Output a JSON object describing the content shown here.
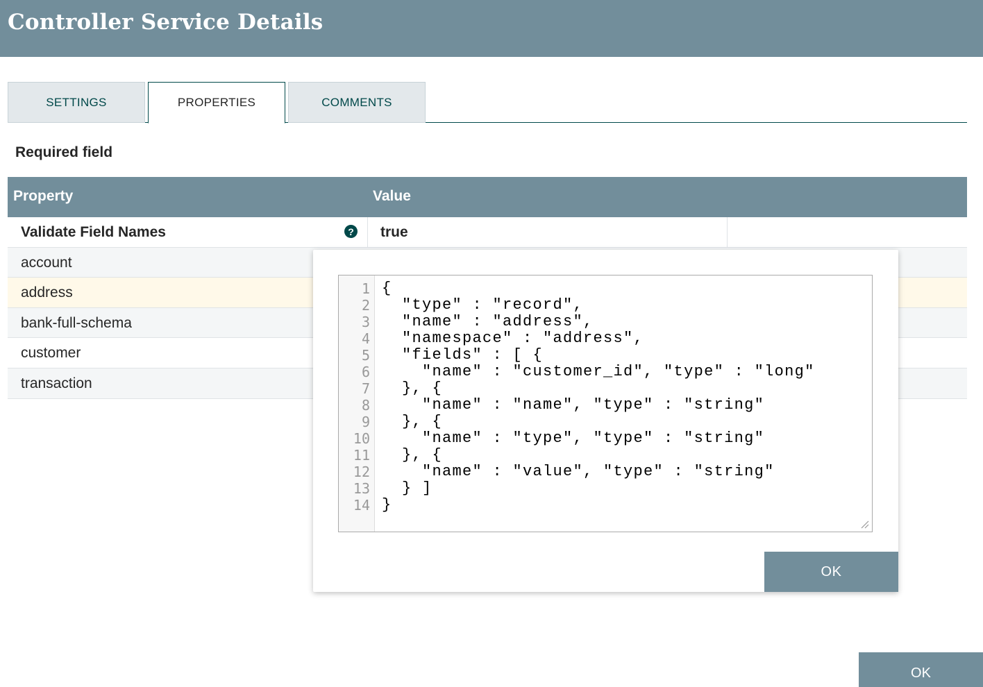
{
  "header": {
    "title": "Controller Service Details"
  },
  "tabs": [
    {
      "label": "SETTINGS",
      "active": false
    },
    {
      "label": "PROPERTIES",
      "active": true
    },
    {
      "label": "COMMENTS",
      "active": false
    }
  ],
  "required_label": "Required field",
  "table": {
    "headers": {
      "property": "Property",
      "value": "Value"
    },
    "rows": [
      {
        "name": "Validate Field Names",
        "value": "true",
        "required": true,
        "has_help": true
      },
      {
        "name": "account",
        "value": ""
      },
      {
        "name": "address",
        "value": "",
        "selected": true
      },
      {
        "name": "bank-full-schema",
        "value": ""
      },
      {
        "name": "customer",
        "value": ""
      },
      {
        "name": "transaction",
        "value": ""
      }
    ]
  },
  "editor": {
    "line_numbers": [
      "1",
      "2",
      "3",
      "4",
      "5",
      "6",
      "7",
      "8",
      "9",
      "10",
      "11",
      "12",
      "13",
      "14"
    ],
    "lines": [
      "{",
      "  \"type\" : \"record\",",
      "  \"name\" : \"address\",",
      "  \"namespace\" : \"address\",",
      "  \"fields\" : [ {",
      "    \"name\" : \"customer_id\", \"type\" : \"long\"",
      "  }, {",
      "    \"name\" : \"name\", \"type\" : \"string\"",
      "  }, {",
      "    \"name\" : \"type\", \"type\" : \"string\"",
      "  }, {",
      "    \"name\" : \"value\", \"type\" : \"string\"",
      "  } ]",
      "}"
    ]
  },
  "popup": {
    "ok_label": "OK"
  },
  "footer": {
    "ok_label": "OK"
  },
  "colors": {
    "header": "#728e9b",
    "accent": "#004849",
    "selected_row": "#fff9e9"
  },
  "icons": {
    "help": "help-circle-icon",
    "resize": "resize-grip-icon"
  }
}
